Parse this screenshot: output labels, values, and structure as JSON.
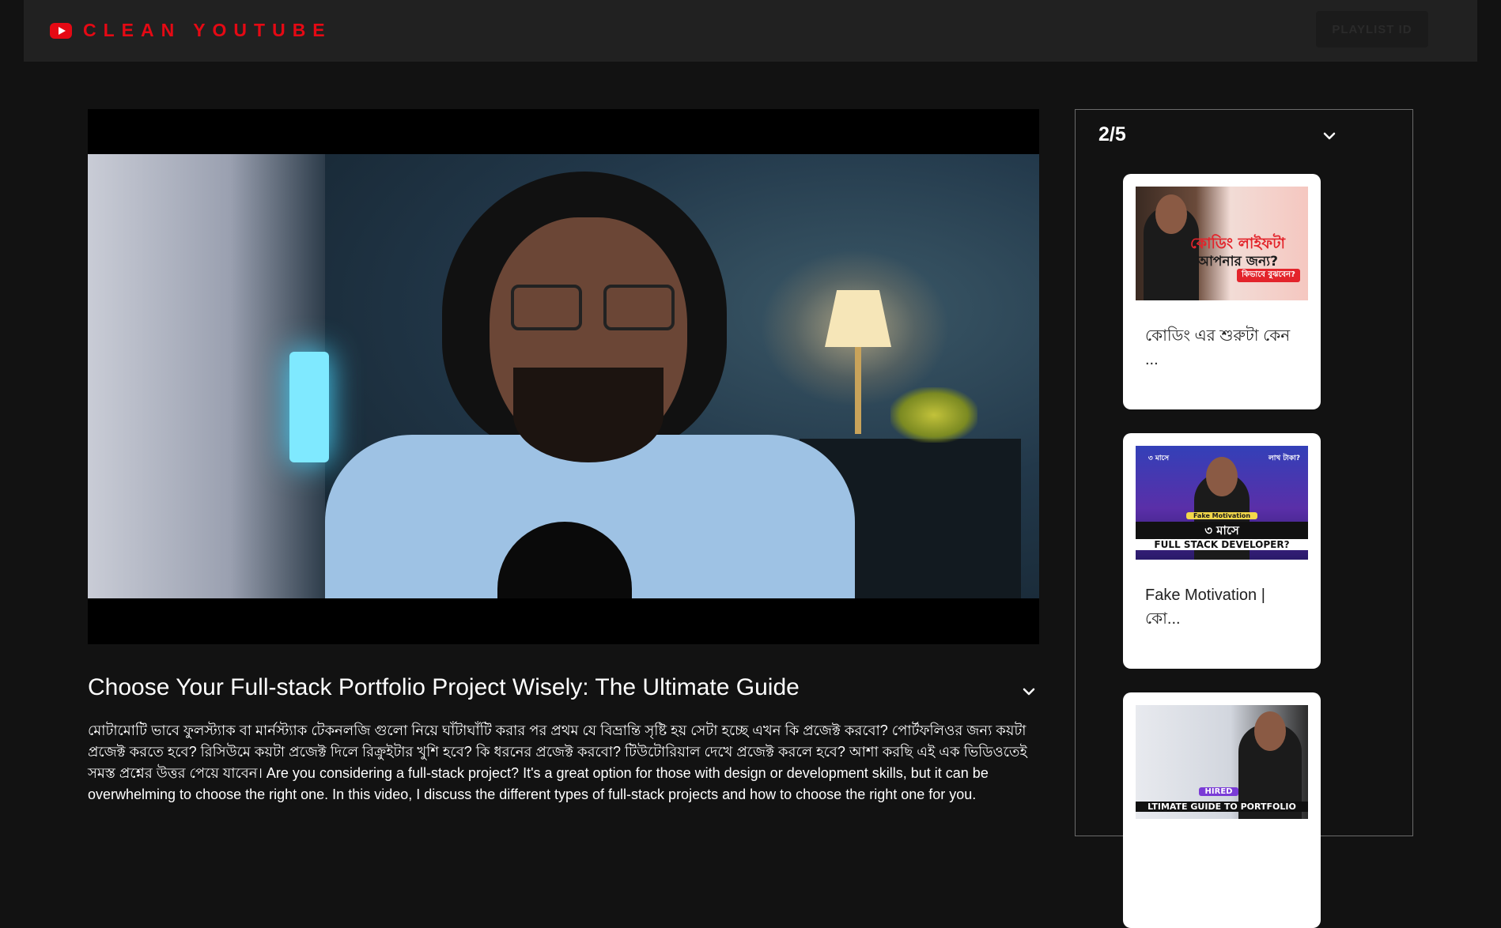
{
  "header": {
    "brand_icon": "youtube-logo-icon",
    "brand": "CLEAN YOUTUBE",
    "brand_color": "#e50914",
    "playlist_button": "PLAYLIST ID"
  },
  "video": {
    "title": "Choose Your Full-stack Portfolio Project Wisely: The Ultimate Guide",
    "description": "মোটামোটি ভাবে ফুলস্ট্যাক বা মার্নস্ট্যাক টেকনলজি গুলো নিয়ে ঘাঁটাঘাঁটি করার পর প্রথম যে বিভ্রান্তি সৃষ্টি হয় সেটা হচ্ছে এখন কি প্রজেক্ট করবো? পোর্টফলিওর জন্য কয়টা প্রজেক্ট করতে হবে? রিসিউমে কয়টা প্রজেক্ট দিলে রিক্রুইটার খুশি হবে? কি ধরনের প্রজেক্ট করবো? টিউটোরিয়াল দেখে প্রজেক্ট করলে হবে? আশা করছি এই এক ভিডিওতেই সমস্ত প্রশ্নের উত্তর পেয়ে যাবেন। Are you considering a full-stack project? It's a great option for those with design or development skills, but it can be overwhelming to choose the right one. In this video, I discuss the different types of full-stack projects and how to choose the right one for you."
  },
  "sidebar": {
    "counter": "2/5",
    "toggle_icon": "chevron-down-icon",
    "items": [
      {
        "title": "কোডিং এর শুরুটা কেন ...",
        "thumb_text_line1": "কোডিং লাইফটা",
        "thumb_text_line2": "আপনার জন্য?",
        "thumb_badge": "কিভাবে বুঝবেন?"
      },
      {
        "title": "Fake Motivation | কো...",
        "thumb_text_top_left": "৩ মাসে",
        "thumb_text_top_right": "লাখ টাকা?",
        "thumb_badge": "Fake Motivation",
        "thumb_text_line1": "৩ মাসে",
        "thumb_text_line2": "FULL STACK DEVELOPER?"
      },
      {
        "title": "",
        "thumb_badge": "HIRED",
        "thumb_text_line1": "LTIMATE GUIDE TO PORTFOLIO"
      }
    ]
  }
}
